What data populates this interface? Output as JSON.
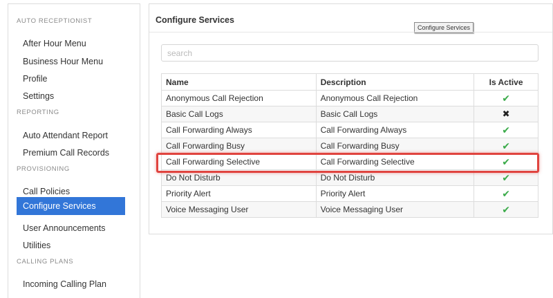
{
  "sidebar": {
    "sections": [
      {
        "heading": "AUTO RECEPTIONIST",
        "items": [
          "After Hour Menu",
          "Business Hour Menu",
          "Profile",
          "Settings"
        ]
      },
      {
        "heading": "REPORTING",
        "items": [
          "Auto Attendant Report",
          "Premium Call Records"
        ]
      },
      {
        "heading": "PROVISIONING",
        "items": [
          "Call Policies",
          "Configure Services",
          "User Announcements",
          "Utilities"
        ]
      },
      {
        "heading": "CALLING PLANS",
        "items": [
          "Incoming Calling Plan"
        ]
      }
    ],
    "active_item": "Configure Services"
  },
  "panel": {
    "title": "Configure Services",
    "tooltip": "Configure Services",
    "search_placeholder": "search"
  },
  "table": {
    "headers": [
      "Name",
      "Description",
      "Is Active"
    ],
    "rows": [
      {
        "name": "Anonymous Call Rejection",
        "description": "Anonymous Call Rejection",
        "active": true
      },
      {
        "name": "Basic Call Logs",
        "description": "Basic Call Logs",
        "active": false
      },
      {
        "name": "Call Forwarding Always",
        "description": "Call Forwarding Always",
        "active": true
      },
      {
        "name": "Call Forwarding Busy",
        "description": "Call Forwarding Busy",
        "active": true
      },
      {
        "name": "Call Forwarding Selective",
        "description": "Call Forwarding Selective",
        "active": true
      },
      {
        "name": "Do Not Disturb",
        "description": "Do Not Disturb",
        "active": true
      },
      {
        "name": "Priority Alert",
        "description": "Priority Alert",
        "active": true
      },
      {
        "name": "Voice Messaging User",
        "description": "Voice Messaging User",
        "active": true
      }
    ],
    "highlighted_row": "Call Forwarding Selective",
    "active_icon": "check-icon",
    "inactive_icon": "cross-icon"
  },
  "colors": {
    "active_nav": "#3276d8",
    "check": "#3bab4a",
    "highlight": "#e0443f"
  }
}
